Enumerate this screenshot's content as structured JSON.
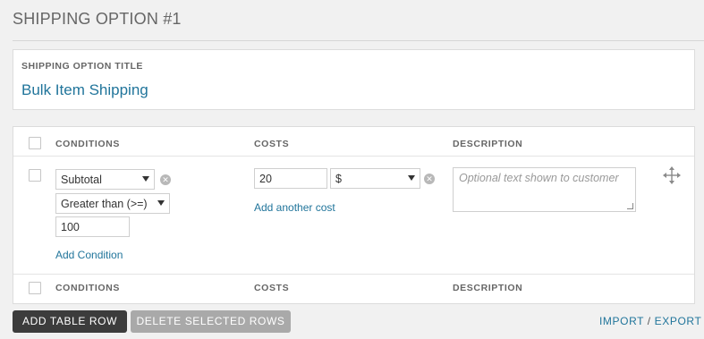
{
  "section": {
    "title": "SHIPPING OPTION #1"
  },
  "option_title": {
    "label": "SHIPPING OPTION TITLE",
    "value": "Bulk Item Shipping"
  },
  "table": {
    "headers": {
      "conditions": "CONDITIONS",
      "costs": "COSTS",
      "description": "DESCRIPTION"
    },
    "row": {
      "condition_field": "Subtotal",
      "condition_operator": "Greater than (>=)",
      "condition_value": "100",
      "add_condition": "Add Condition",
      "cost_value": "20",
      "cost_type": "$",
      "add_cost": "Add another cost",
      "description_placeholder": "Optional text shown to customer"
    }
  },
  "actions": {
    "add_row": "ADD TABLE ROW",
    "delete_rows": "DELETE SELECTED ROWS",
    "import": "IMPORT",
    "separator": "/",
    "export": "EXPORT"
  }
}
